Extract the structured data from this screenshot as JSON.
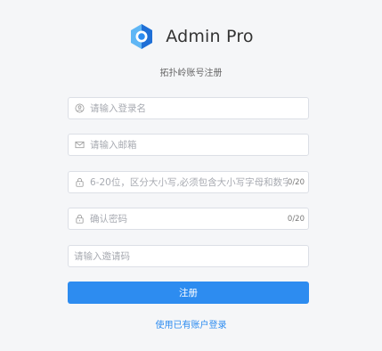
{
  "header": {
    "app_title": "Admin Pro",
    "subtitle": "拓扑岭账号注册"
  },
  "form": {
    "username": {
      "placeholder": "请输入登录名",
      "value": "",
      "icon": "user-circle-icon"
    },
    "email": {
      "placeholder": "请输入邮箱",
      "value": "",
      "icon": "mail-icon"
    },
    "password": {
      "placeholder": "6-20位，区分大小写,必须包含大小写字母和数字",
      "value": "",
      "icon": "lock-icon",
      "counter": "0/20"
    },
    "confirm_password": {
      "placeholder": "确认密码",
      "value": "",
      "icon": "lock-icon",
      "counter": "0/20"
    },
    "invite_code": {
      "placeholder": "请输入邀请码",
      "value": ""
    },
    "submit_label": "注册",
    "login_link": "使用已有账户登录"
  },
  "colors": {
    "accent": "#2d8cf0",
    "logo_dark": "#1f6fd6",
    "logo_light": "#5fb6f5",
    "background": "#f5f6f8"
  }
}
